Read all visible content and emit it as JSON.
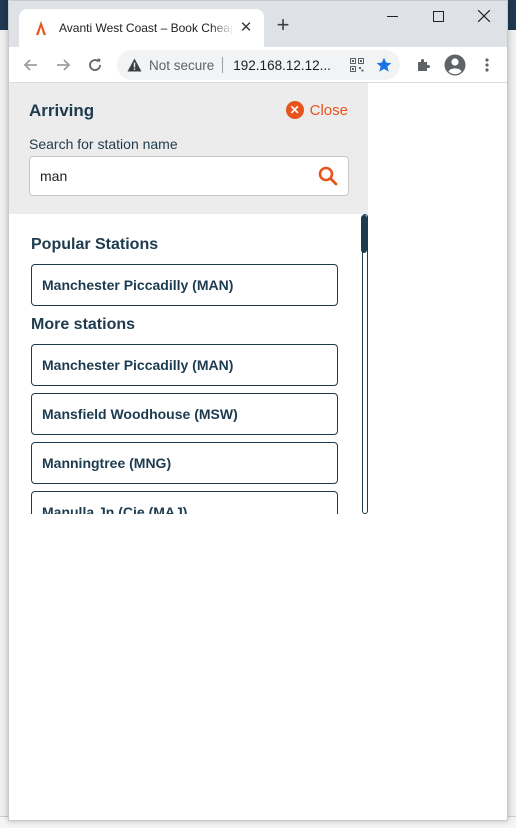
{
  "browser": {
    "tab_title": "Avanti West Coast – Book Cheap",
    "omnibox_security": "Not secure",
    "omnibox_url": "192.168.12.12..."
  },
  "panel": {
    "heading": "Arriving",
    "close_label": "Close",
    "search_label": "Search for station name",
    "search_value": "man"
  },
  "popular": {
    "title": "Popular Stations",
    "items": [
      "Manchester Piccadilly (MAN)"
    ]
  },
  "more": {
    "title": "More stations",
    "items": [
      "Manchester Piccadilly (MAN)",
      "Mansfield Woodhouse (MSW)",
      "Manningtree (MNG)",
      "Manulla Jn (Cie (MAJ)"
    ]
  },
  "colors": {
    "brand_dark": "#1d3b4f",
    "accent_orange": "#e8541e"
  }
}
